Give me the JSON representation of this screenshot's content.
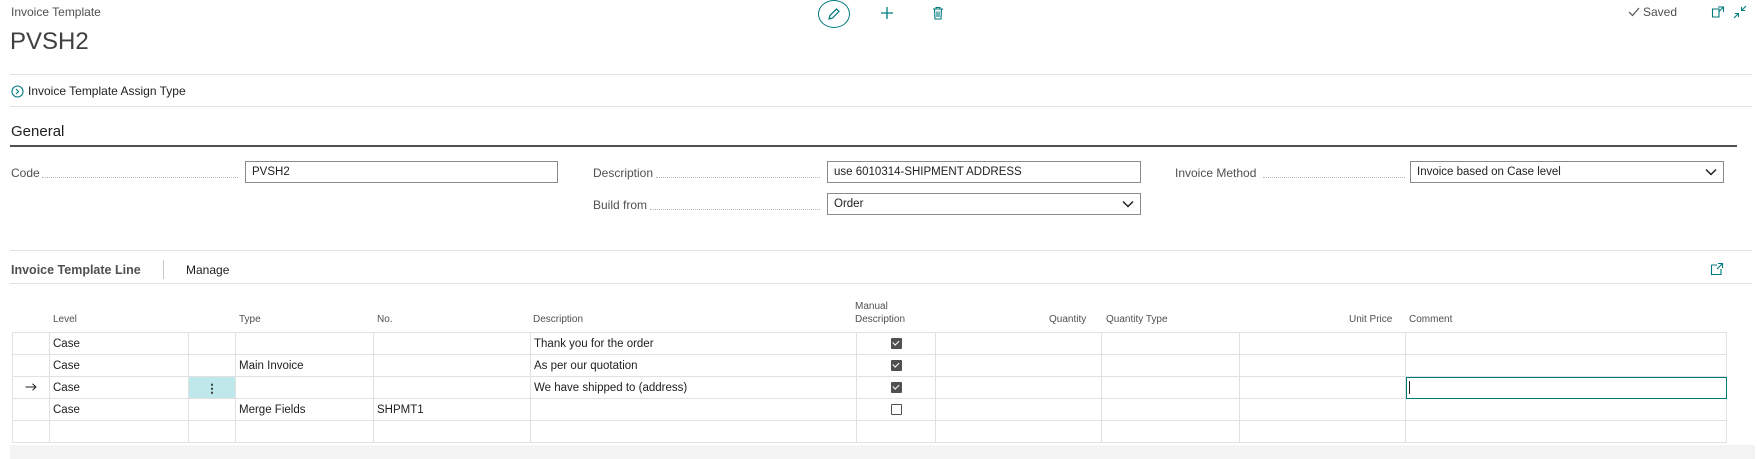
{
  "header": {
    "caption": "Invoice Template",
    "title": "PVSH2",
    "status": "Saved"
  },
  "actions": {
    "assign_type": "Invoice Template Assign Type"
  },
  "general": {
    "title": "General",
    "fields": {
      "code": {
        "label": "Code",
        "value": "PVSH2"
      },
      "description": {
        "label": "Description",
        "value": "use 6010314-SHIPMENT ADDRESS"
      },
      "build_from": {
        "label": "Build from",
        "value": "Order"
      },
      "invoice_method": {
        "label": "Invoice Method",
        "value": "Invoice based on Case level"
      }
    }
  },
  "lines": {
    "title": "Invoice Template Line",
    "manage": "Manage",
    "columns": {
      "level": "Level",
      "type": "Type",
      "no": "No.",
      "description": "Description",
      "manual_description_1": "Manual",
      "manual_description_2": "Description",
      "quantity": "Quantity",
      "quantity_type": "Quantity Type",
      "unit_price": "Unit Price",
      "comment": "Comment"
    },
    "rows": [
      {
        "level": "Case",
        "type": "",
        "no": "",
        "description": "Thank you for the order",
        "manual": true
      },
      {
        "level": "Case",
        "type": "Main Invoice",
        "no": "",
        "description": "As per our quotation",
        "manual": true
      },
      {
        "level": "Case",
        "type": "",
        "no": "",
        "description": "We have shipped to (address)",
        "manual": true,
        "current": true
      },
      {
        "level": "Case",
        "type": "Merge Fields",
        "no": "SHPMT1",
        "description": "",
        "manual": false
      }
    ]
  },
  "icons": {
    "edit": "pencil-icon",
    "add": "plus-icon",
    "delete": "trash-icon",
    "saved": "checkmark-icon",
    "open_new": "open-in-new-window-icon",
    "collapse": "collapse-icon",
    "assign": "circle-arrow-icon",
    "row_indicator": "arrow-right-icon",
    "row_menu": "vertical-ellipsis-icon",
    "expand_lines": "expand-icon"
  },
  "colors": {
    "accent": "#00797e",
    "selected_cell": "#bfe8ea"
  }
}
